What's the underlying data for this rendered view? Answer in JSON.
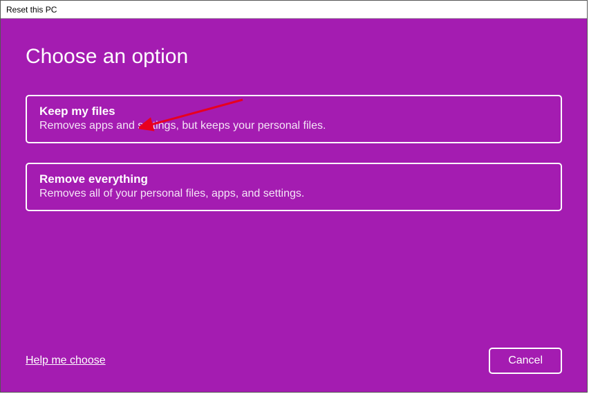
{
  "titlebar": "Reset this PC",
  "heading": "Choose an option",
  "options": [
    {
      "title": "Keep my files",
      "desc": "Removes apps and settings, but keeps your personal files."
    },
    {
      "title": "Remove everything",
      "desc": "Removes all of your personal files, apps, and settings."
    }
  ],
  "help_link": "Help me choose",
  "cancel_label": "Cancel",
  "annotation": {
    "arrow_color": "#e8001f"
  }
}
